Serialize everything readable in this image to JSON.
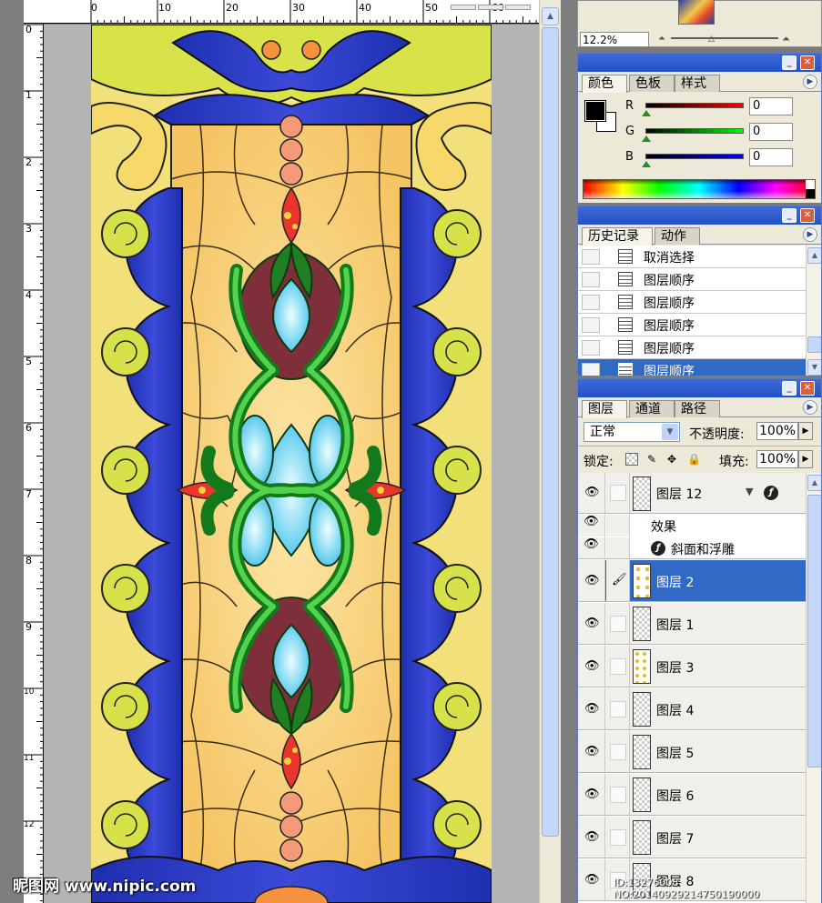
{
  "navigator": {
    "zoom": "12.2%"
  },
  "ruler": {
    "top_marks": [
      "0",
      "10",
      "20",
      "30",
      "40",
      "50",
      "60"
    ],
    "left_marks": [
      "0",
      "1",
      "2",
      "3",
      "4",
      "5",
      "6",
      "7",
      "8",
      "9",
      "10",
      "11",
      "12"
    ]
  },
  "color_palette": {
    "tabs": [
      "颜色",
      "色板",
      "样式"
    ],
    "active_tab": "颜色",
    "r_label": "R",
    "g_label": "G",
    "b_label": "B",
    "r_value": "0",
    "g_value": "0",
    "b_value": "0",
    "foreground": "#000000",
    "background": "#ffffff"
  },
  "history_palette": {
    "tabs": [
      "历史记录",
      "动作"
    ],
    "items": [
      {
        "label": "取消选择"
      },
      {
        "label": "图层顺序"
      },
      {
        "label": "图层顺序"
      },
      {
        "label": "图层顺序"
      },
      {
        "label": "图层顺序"
      },
      {
        "label": "图层顺序"
      }
    ]
  },
  "layers_palette": {
    "tabs": [
      "图层",
      "通道",
      "路径"
    ],
    "blend_mode": "正常",
    "opacity_label": "不透明度:",
    "opacity": "100%",
    "lock_label": "锁定:",
    "fill_label": "填充:",
    "fill": "100%",
    "effects_label": "效果",
    "effect_name": "斜面和浮雕",
    "layers": [
      {
        "name": "图层 12"
      },
      {
        "name": "图层 2"
      },
      {
        "name": "图层 1"
      },
      {
        "name": "图层 3"
      },
      {
        "name": "图层 4"
      },
      {
        "name": "图层 5"
      },
      {
        "name": "图层 6"
      },
      {
        "name": "图层 7"
      },
      {
        "name": "图层 8"
      }
    ]
  },
  "watermark": {
    "left": "昵图网 www.nipic.com",
    "right": "ID:13276008 NO:20140929214750190000"
  },
  "colors": {
    "selection": "#316ac5",
    "title_bar": "#2451c4",
    "panel": "#ece9d8"
  }
}
